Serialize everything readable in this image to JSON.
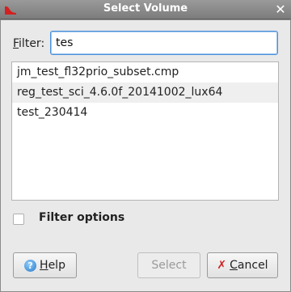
{
  "window": {
    "title": "Select Volume"
  },
  "filter": {
    "label_accel": "F",
    "label_rest": "ilter:",
    "value": "tes"
  },
  "list": {
    "items": [
      "jm_test_fl32prio_subset.cmp",
      "reg_test_sci_4.6.0f_20141002_lux64",
      "test_230414"
    ]
  },
  "options": {
    "filter_options_label": "Filter options",
    "checked": false
  },
  "buttons": {
    "help_accel": "H",
    "help_rest": "elp",
    "select": "Select",
    "cancel_accel": "C",
    "cancel_rest": "ancel"
  },
  "icons": {
    "app": "red-volume-icon",
    "close": "close-x-icon",
    "help": "question-circle-icon",
    "cancel": "red-x-icon"
  },
  "colors": {
    "accent": "#4a90d9",
    "titlebar": "#8a8a8a"
  }
}
